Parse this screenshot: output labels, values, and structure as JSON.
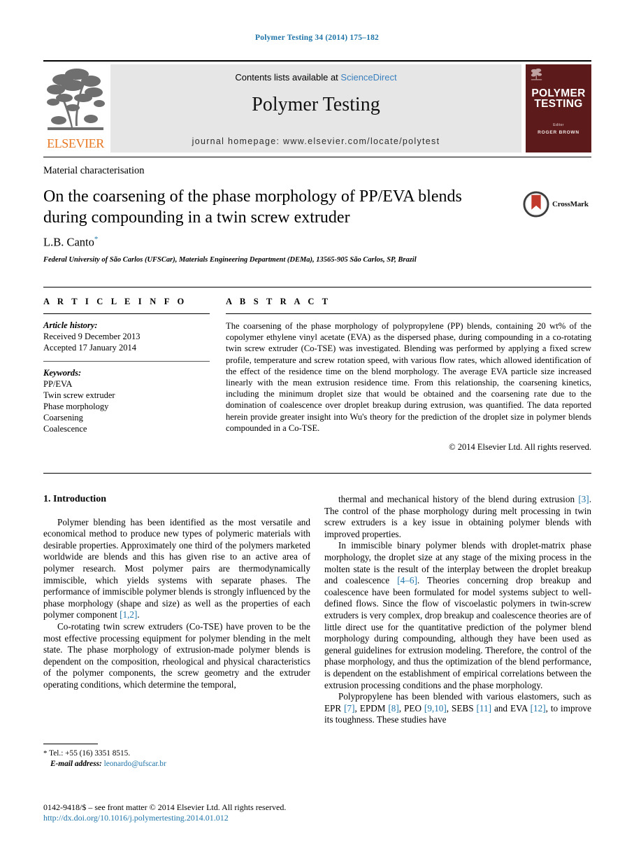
{
  "running_head": "Polymer Testing 34 (2014) 175–182",
  "masthead": {
    "contents_prefix": "Contents lists available at ",
    "sciencedirect": "ScienceDirect",
    "journal_title": "Polymer Testing",
    "homepage": "journal homepage: www.elsevier.com/locate/polytest",
    "publisher_wordmark": "ELSEVIER",
    "cover": {
      "title_line1": "POLYMER",
      "title_line2": "TESTING",
      "editor_label": "Editor",
      "editor_name": "ROGER BROWN",
      "background_color": "#5d1a1a"
    },
    "sciencedirect_color": "#3a80bf",
    "band_color": "#e6e6e6",
    "elsevier_orange": "#e87722"
  },
  "article": {
    "section_label": "Material characterisation",
    "title": "On the coarsening of the phase morphology of PP/EVA blends during compounding in a twin screw extruder",
    "author": "L.B. Canto",
    "author_marker": "*",
    "affiliation": "Federal University of São Carlos (UFSCar), Materials Engineering Department (DEMa), 13565-905 São Carlos, SP, Brazil",
    "crossmark_label": "CrossMark"
  },
  "info": {
    "heading": "A R T I C L E   I N F O",
    "history_label": "Article history:",
    "received": "Received 9 December 2013",
    "accepted": "Accepted 17 January 2014",
    "keywords_label": "Keywords:",
    "keywords": [
      "PP/EVA",
      "Twin screw extruder",
      "Phase morphology",
      "Coarsening",
      "Coalescence"
    ]
  },
  "abstract": {
    "heading": "A B S T R A C T",
    "text": "The coarsening of the phase morphology of polypropylene (PP) blends, containing 20 wt% of the copolymer ethylene vinyl acetate (EVA) as the dispersed phase, during compounding in a co-rotating twin screw extruder (Co-TSE) was investigated. Blending was performed by applying a fixed screw profile, temperature and screw rotation speed, with various flow rates, which allowed identification of the effect of the residence time on the blend morphology. The average EVA particle size increased linearly with the mean extrusion residence time. From this relationship, the coarsening kinetics, including the minimum droplet size that would be obtained and the coarsening rate due to the domination of coalescence over droplet breakup during extrusion, was quantified. The data reported herein provide greater insight into Wu's theory for the prediction of the droplet size in polymer blends compounded in a Co-TSE.",
    "copyright": "© 2014 Elsevier Ltd. All rights reserved."
  },
  "body": {
    "heading": "1. Introduction",
    "left_paragraphs": [
      "Polymer blending has been identified as the most versatile and economical method to produce new types of polymeric materials with desirable properties. Approximately one third of the polymers marketed worldwide are blends and this has given rise to an active area of polymer research. Most polymer pairs are thermodynamically immiscible, which yields systems with separate phases. The performance of immiscible polymer blends is strongly influenced by the phase morphology (shape and size) as well as the properties of each polymer component [1,2].",
      "Co-rotating twin screw extruders (Co-TSE) have proven to be the most effective processing equipment for polymer blending in the melt state. The phase morphology of extrusion-made polymer blends is dependent on the composition, rheological and physical characteristics of the polymer components, the screw geometry and the extruder operating conditions, which determine the temporal,"
    ],
    "right_paragraphs": [
      "thermal and mechanical history of the blend during extrusion [3]. The control of the phase morphology during melt processing in twin screw extruders is a key issue in obtaining polymer blends with improved properties.",
      "In immiscible binary polymer blends with droplet-matrix phase morphology, the droplet size at any stage of the mixing process in the molten state is the result of the interplay between the droplet breakup and coalescence [4–6]. Theories concerning drop breakup and coalescence have been formulated for model systems subject to well-defined flows. Since the flow of viscoelastic polymers in twin-screw extruders is very complex, drop breakup and coalescence theories are of little direct use for the quantitative prediction of the polymer blend morphology during compounding, although they have been used as general guidelines for extrusion modeling. Therefore, the control of the phase morphology, and thus the optimization of the blend performance, is dependent on the establishment of empirical correlations between the extrusion processing conditions and the phase morphology.",
      "Polypropylene has been blended with various elastomers, such as EPR [7], EPDM [8], PEO [9,10], SEBS [11] and EVA [12], to improve its toughness. These studies have"
    ],
    "link_color": "#1f74a8"
  },
  "footnote": {
    "marker": "*",
    "tel": "Tel.: +55 (16) 3351 8515.",
    "email_label": "E-mail address:",
    "email": "leonardo@ufscar.br"
  },
  "footer": {
    "issn_line": "0142-9418/$ – see front matter © 2014 Elsevier Ltd. All rights reserved.",
    "doi": "http://dx.doi.org/10.1016/j.polymertesting.2014.01.012"
  }
}
